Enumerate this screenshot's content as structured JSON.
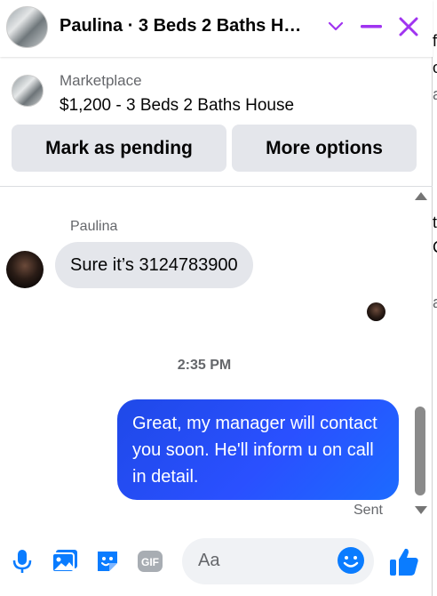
{
  "header": {
    "title": "Paulina · 3 Beds 2 Baths H…",
    "accent_color": "#a034f0"
  },
  "marketplace": {
    "label": "Marketplace",
    "listing": "$1,200 - 3 Beds 2 Baths House",
    "mark_pending_label": "Mark as pending",
    "more_options_label": "More options"
  },
  "thread": {
    "sender_name": "Paulina",
    "incoming_message": "Sure it’s 3124783900",
    "timestamp": "2:35 PM",
    "outgoing_message": "Great, my manager will contact you soon. He'll inform u on call in detail.",
    "status": "Sent"
  },
  "composer": {
    "placeholder": "Aa",
    "icon_color": "#0a7cff",
    "icons": [
      "microphone-icon",
      "photo-icon",
      "sticker-icon",
      "gif-icon",
      "emoji-icon",
      "thumbs-up-icon"
    ]
  },
  "behind_fragments": [
    "f",
    "o",
    "a",
    "t",
    "C",
    "a"
  ]
}
